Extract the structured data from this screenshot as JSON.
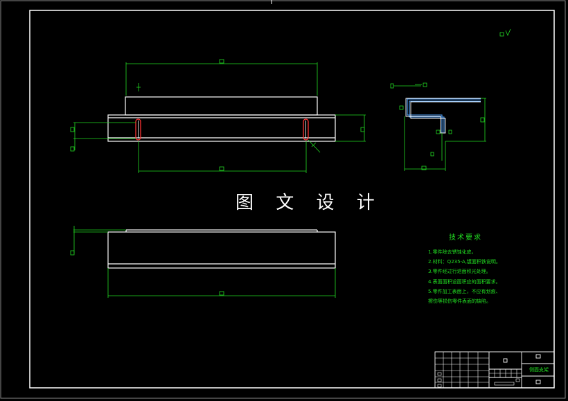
{
  "drawing": {
    "watermark": "图 文 设 计",
    "notes_title": "技术要求",
    "notes": [
      "1.零件除去锈蚀化皮。",
      "2.材料：Q235-A,镀面积铁说明。",
      "3.零件经过行退面积光处理。",
      "4.表面面积设面积应的面积要求。",
      "5.零件加工表面上，不应有划痕、",
      "擦伤等损伤零件表面的缺陷。"
    ],
    "title_block_name": "侧面支架"
  },
  "colors": {
    "background": "#000000",
    "outline": "#ffffff",
    "dimension": "#22dd22",
    "hole": "#ff3333",
    "section": "#4fa3ff"
  }
}
